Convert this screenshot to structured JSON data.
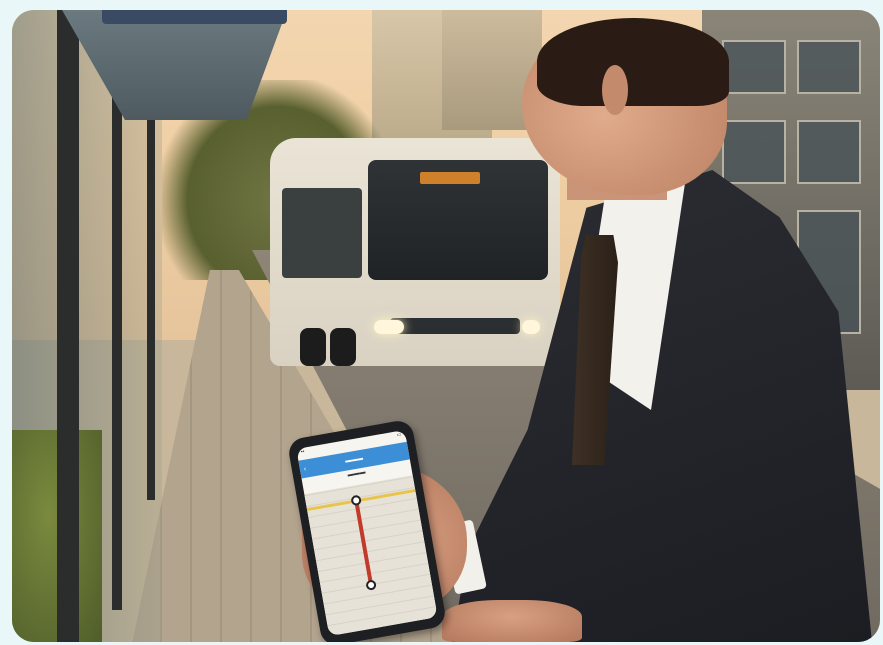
{
  "scene": {
    "subject": "businessman",
    "colors": {
      "background": "#eaf7f9",
      "sky": "#f0cfa4",
      "bus_body": "#e6e0d2",
      "suit": "#24262b",
      "app_header": "#3c8fd6",
      "route_line": "#c23a2a"
    }
  },
  "phone": {
    "app_bar_icon": "back-arrow-icon"
  }
}
